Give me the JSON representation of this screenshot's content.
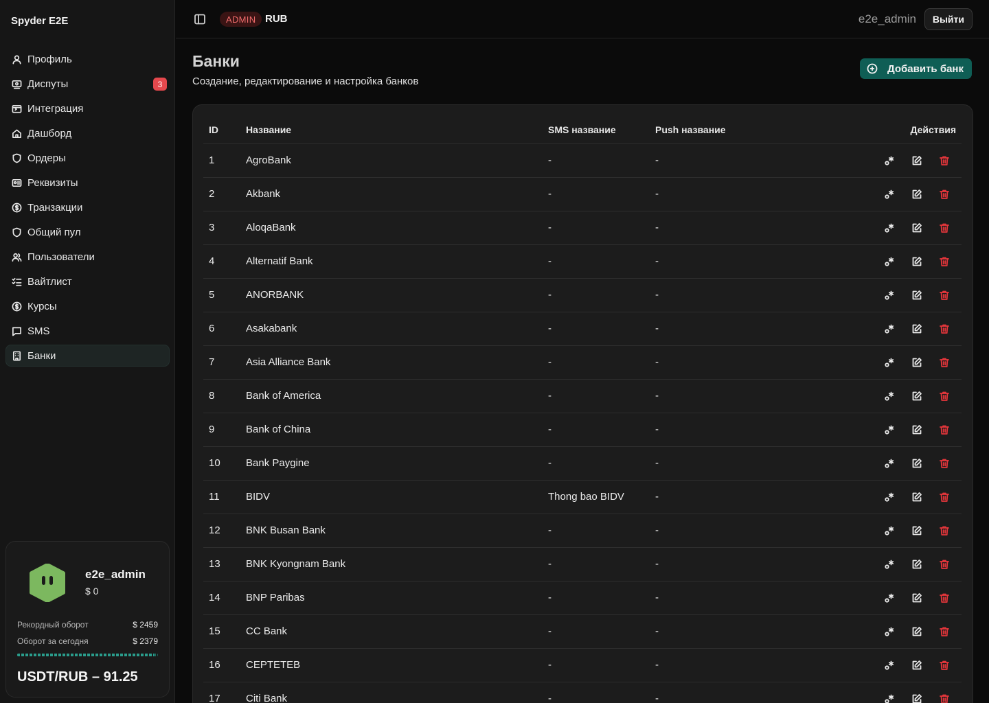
{
  "brand": "Spyder E2E",
  "sidebar": {
    "items": [
      {
        "label": "Профиль",
        "icon": "user-icon"
      },
      {
        "label": "Диспуты",
        "icon": "dispute-icon",
        "badge": "3"
      },
      {
        "label": "Интеграция",
        "icon": "integration-icon"
      },
      {
        "label": "Дашборд",
        "icon": "home-icon"
      },
      {
        "label": "Ордеры",
        "icon": "shield-icon"
      },
      {
        "label": "Реквизиты",
        "icon": "id-card-icon"
      },
      {
        "label": "Транзакции",
        "icon": "dollar-circle-icon"
      },
      {
        "label": "Общий пул",
        "icon": "shield-icon"
      },
      {
        "label": "Пользователи",
        "icon": "users-icon"
      },
      {
        "label": "Вайтлист",
        "icon": "checklist-icon"
      },
      {
        "label": "Курсы",
        "icon": "dollar-circle-icon"
      },
      {
        "label": "SMS",
        "icon": "message-icon"
      },
      {
        "label": "Банки",
        "icon": "building-icon",
        "active": true
      }
    ]
  },
  "user_card": {
    "name": "e2e_admin",
    "balance": "$ 0",
    "record_label": "Рекордный оборот",
    "record_value": "$ 2459",
    "today_label": "Оборот за сегодня",
    "today_value": "$ 2379",
    "progress": 0.97,
    "rate": "USDT/RUB – 91.25"
  },
  "topbar": {
    "role_badge": "ADMIN",
    "currency": "RUB",
    "username": "e2e_admin",
    "logout_label": "Выйти"
  },
  "page": {
    "title": "Банки",
    "subtitle": "Создание, редактирование и настройка банков",
    "add_button": "Добавить банк"
  },
  "table": {
    "headers": {
      "id": "ID",
      "name": "Название",
      "sms": "SMS название",
      "push": "Push название",
      "actions": "Действия"
    },
    "rows": [
      {
        "id": "1",
        "name": "AgroBank",
        "sms": "-",
        "push": "-"
      },
      {
        "id": "2",
        "name": "Akbank",
        "sms": "-",
        "push": "-"
      },
      {
        "id": "3",
        "name": "AloqaBank",
        "sms": "-",
        "push": "-"
      },
      {
        "id": "4",
        "name": "Alternatif Bank",
        "sms": "-",
        "push": "-"
      },
      {
        "id": "5",
        "name": "ANORBANK",
        "sms": "-",
        "push": "-"
      },
      {
        "id": "6",
        "name": "Asakabank",
        "sms": "-",
        "push": "-"
      },
      {
        "id": "7",
        "name": "Asia Alliance Bank",
        "sms": "-",
        "push": "-"
      },
      {
        "id": "8",
        "name": "Bank of America",
        "sms": "-",
        "push": "-"
      },
      {
        "id": "9",
        "name": "Bank of China",
        "sms": "-",
        "push": "-"
      },
      {
        "id": "10",
        "name": "Bank Paygine",
        "sms": "-",
        "push": "-"
      },
      {
        "id": "11",
        "name": "BIDV",
        "sms": "Thong bao BIDV",
        "push": "-"
      },
      {
        "id": "12",
        "name": "BNK Busan Bank",
        "sms": "-",
        "push": "-"
      },
      {
        "id": "13",
        "name": "BNK Kyongnam Bank",
        "sms": "-",
        "push": "-"
      },
      {
        "id": "14",
        "name": "BNP Paribas",
        "sms": "-",
        "push": "-"
      },
      {
        "id": "15",
        "name": "CC Bank",
        "sms": "-",
        "push": "-"
      },
      {
        "id": "16",
        "name": "CEPTETEB",
        "sms": "-",
        "push": "-"
      },
      {
        "id": "17",
        "name": "Citi Bank",
        "sms": "-",
        "push": "-"
      }
    ]
  },
  "colors": {
    "accent": "#0f5e55",
    "danger": "#e5363b",
    "badge": "#e5484d"
  }
}
